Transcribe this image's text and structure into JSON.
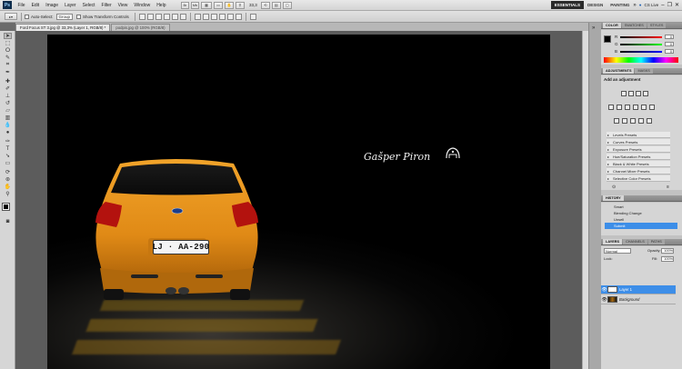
{
  "app": {
    "logo": "Ps"
  },
  "menu": [
    "File",
    "Edit",
    "Image",
    "Layer",
    "Select",
    "Filter",
    "View",
    "Window",
    "Help"
  ],
  "toolbar_extras": {
    "zoom": "33,3",
    "cslive": "CS Live"
  },
  "workspaces": [
    "ESSENTIALS",
    "DESIGN",
    "PAINTING"
  ],
  "options": {
    "auto_select_label": "Auto-Select:",
    "auto_select_value": "Group",
    "transform_label": "Show Transform Controls"
  },
  "doc_tabs": [
    {
      "label": "Ford Focus ST 3.jpg @ 33,3% (Layer 1, RGB/8) *",
      "active": true
    },
    {
      "label": "podpis.jpg @ 100% (RGB/8)",
      "active": false
    }
  ],
  "signature": {
    "text": "Gašper Piron"
  },
  "license_plate": "LJ · AA-290",
  "color_panel": {
    "tabs": [
      "COLOR",
      "SWATCHES",
      "STYLES"
    ],
    "channels": [
      {
        "label": "R",
        "value": "0"
      },
      {
        "label": "G",
        "value": "0"
      },
      {
        "label": "B",
        "value": "0"
      }
    ]
  },
  "adjustments_panel": {
    "tabs": [
      "ADJUSTMENTS",
      "MASKS"
    ],
    "heading": "Add an adjustment",
    "presets": [
      "Levels Presets",
      "Curves Presets",
      "Exposure Presets",
      "Hue/Saturation Presets",
      "Black & White Presets",
      "Channel Mixer Presets",
      "Selective Color Presets"
    ]
  },
  "history_panel": {
    "tabs": [
      "HISTORY"
    ],
    "items": [
      "Smart",
      "Blending Change",
      "Unsell",
      "Submit"
    ],
    "selected_index": 3
  },
  "layers_panel": {
    "tabs": [
      "LAYERS",
      "CHANNELS",
      "PATHS"
    ],
    "blend_mode": "Normal",
    "opacity_label": "Opacity:",
    "opacity": "100%",
    "lock_label": "Lock:",
    "fill_label": "Fill:",
    "fill": "100%",
    "layers": [
      {
        "name": "Layer 1",
        "selected": true,
        "italic": false
      },
      {
        "name": "Background",
        "selected": false,
        "italic": true
      }
    ]
  },
  "colors": {
    "accent": "#3d8ee8",
    "car_orange": "#e8961c",
    "panel_bg": "#d5d5d5"
  }
}
